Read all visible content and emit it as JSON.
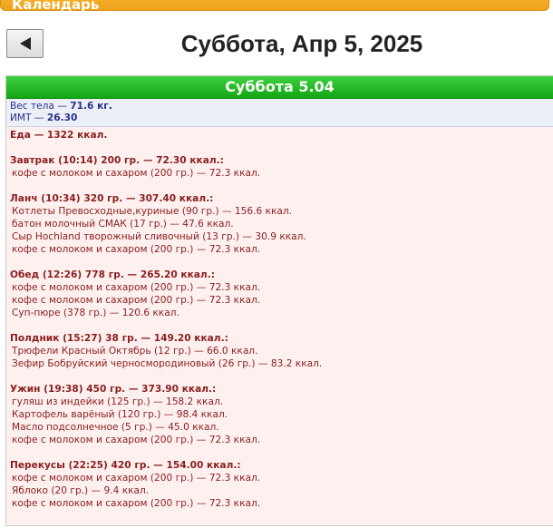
{
  "app": {
    "title": "Календарь"
  },
  "nav": {
    "back_label": "◄"
  },
  "date_title": "Суббота, Апр 5, 2025",
  "day": {
    "header": "Суббота 5.04",
    "weight": {
      "label": "Вес тела — ",
      "value": "71.6 кг."
    },
    "bmi": {
      "label": "ИМТ — ",
      "value": "26.30"
    },
    "food_total": "Еда — 1322 ккал.",
    "meals": [
      {
        "title": "Завтрак (10:14) 200 гр. — 72.30 ккал.:",
        "items": [
          "кофе с молоком и сахаром (200 гр.) — 72.3 ккал."
        ]
      },
      {
        "title": "Ланч (10:34) 320 гр. — 307.40 ккал.:",
        "items": [
          "Котлеты Превосходные,куриные (90 гр.) — 156.6 ккал.",
          "батон молочный СМАК (17 гр.) — 47.6 ккал.",
          "Сыр Hochland творожный сливочный (13 гр.) — 30.9 ккал.",
          "кофе с молоком и сахаром (200 гр.) — 72.3 ккал."
        ]
      },
      {
        "title": "Обед (12:26) 778 гр. — 265.20 ккал.:",
        "items": [
          "кофе с молоком и сахаром (200 гр.) — 72.3 ккал.",
          "кофе с молоком и сахаром (200 гр.) — 72.3 ккал.",
          "Суп-пюре (378 гр.) — 120.6 ккал."
        ]
      },
      {
        "title": "Полдник (15:27) 38 гр. — 149.20 ккал.:",
        "items": [
          "Трюфели Красный Октябрь (12 гр.) — 66.0 ккал.",
          "Зефир Бобруйский черносмородиновый (26 гр.) — 83.2 ккал."
        ]
      },
      {
        "title": "Ужин (19:38) 450 гр. — 373.90 ккал.:",
        "items": [
          "гуляш из индейки (125 гр.) — 158.2 ккал.",
          "Картофель варёный (120 гр.) — 98.4 ккал.",
          "Масло подсолнечное (5 гр.) — 45.0 ккал.",
          "кофе с молоком и сахаром (200 гр.) — 72.3 ккал."
        ]
      },
      {
        "title": "Перекусы (22:25) 420 гр. — 154.00 ккал.:",
        "items": [
          "кофе с молоком и сахаром (200 гр.) — 72.3 ккал.",
          "Яблоко (20 гр.) — 9.4 ккал.",
          "кофе с молоком и сахаром (200 гр.) — 72.3 ккал."
        ]
      }
    ]
  },
  "colors": {
    "app_bar": "#f0a21b",
    "day_header": "#14a514",
    "stats_text": "#24318a",
    "food_text": "#8a2020",
    "panel_bg": "#fff0f0"
  }
}
